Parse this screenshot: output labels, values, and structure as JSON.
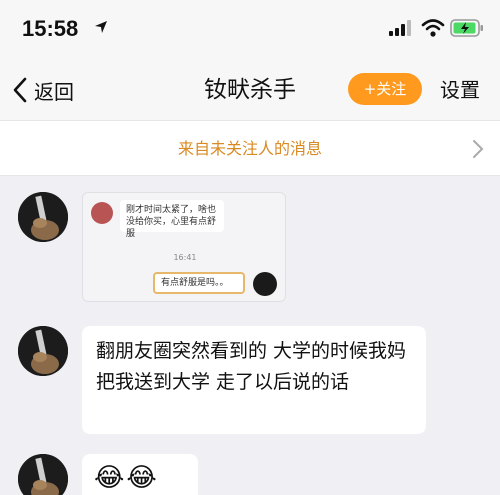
{
  "status_bar": {
    "time": "15:58"
  },
  "nav": {
    "back_label": "返回",
    "title": "钕畎杀手",
    "follow_label": "+关注",
    "settings_label": "设置"
  },
  "banner": {
    "text": "来自未关注人的消息"
  },
  "messages": [
    {
      "type": "image",
      "screenshot": {
        "incoming_text": "刚才时间太紧了，啥也没给你买，心里有点舒服",
        "time": "16:41",
        "outgoing_text": "有点舒服是吗。。"
      }
    },
    {
      "type": "text",
      "text": "翻朋友圈突然看到的 大学的时候我妈把我送到大学 走了以后说的话"
    },
    {
      "type": "emoji",
      "text": "😂😂😂"
    }
  ],
  "colors": {
    "accent": "#ff9a1f",
    "banner_text": "#d98a22",
    "background": "#efeff4"
  }
}
